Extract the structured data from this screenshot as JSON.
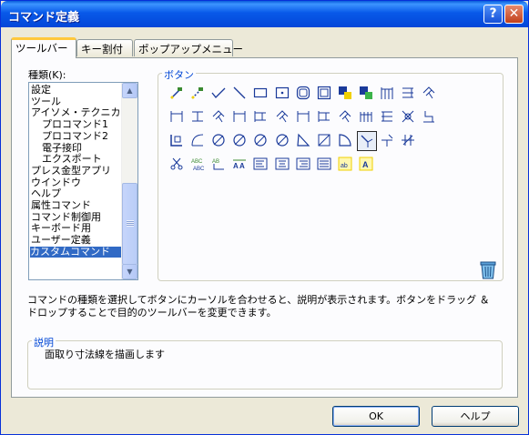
{
  "window": {
    "title": "コマンド定義"
  },
  "tabs": [
    "ツールバー",
    "キー割付",
    "ポップアップメニュー"
  ],
  "category": {
    "label": "種類(K):",
    "items": [
      "設定",
      "ツール",
      "アイソメ・テクニカル",
      "プロコマンド1",
      "プロコマンド2",
      "電子接印",
      "エクスポート",
      "プレス金型アプリ",
      "ウインドウ",
      "ヘルプ",
      "属性コマンド",
      "コマンド制御用",
      "キーボード用",
      "ユーザー定義",
      "カスタムコマンド"
    ],
    "selected": "カスタムコマンド"
  },
  "buttons_group": {
    "label": "ボタン",
    "rows": [
      [
        "line-pen-icon",
        "line-pen-dotted-icon",
        "check-angle-icon",
        "diagonal-line-icon",
        "rectangle-icon",
        "rectangle-dot-icon",
        "rounded-square-icon",
        "double-square-icon",
        "yellow-block-icon",
        "green-block-icon",
        "dimension-h-icon",
        "dimension-stack-icon",
        "dimension-angle-icon"
      ],
      [
        "dimension-span-icon",
        "dimension-bracket-icon",
        "dimension-angle-icon",
        "dimension-span-icon",
        "dimension-vert-icon",
        "dimension-angle-icon",
        "dimension-span-icon",
        "dimension-vert-icon",
        "dimension-angle-icon",
        "dimension-multi-icon",
        "dimension-right-icon",
        "cross-dimension-icon",
        "ordinate-icon"
      ],
      [
        "l-shape-icon",
        "arc-dimension-icon",
        "circle-slash-icon",
        "circle-slash-icon",
        "circle-slash-icon",
        "circle-slash-icon",
        "triangle-icon",
        "square-slash-icon",
        "quarter-arc-icon",
        "chamfer-dimension-icon",
        "leader-icon",
        "cross-hatch-icon"
      ],
      [
        "scissors-icon",
        "abc-replace-icon",
        "text-leader-icon",
        "text-aa-icon",
        "text-align-left-icon",
        "text-align-center-icon",
        "text-align-right-icon",
        "text-justify-icon",
        "yellow-text-box-icon",
        "yellow-text-a-icon"
      ]
    ],
    "selected_icon": "chamfer-dimension-icon"
  },
  "trash_icon": "recycle-bin-icon",
  "instruction": "コマンドの種類を選択してボタンにカーソルを合わせると、説明が表示されます。ボタンをドラッグ ＆ ドロップすることで目的のツールバーを変更できます。",
  "description": {
    "label": "説明",
    "text": "面取り寸法線を描画します"
  },
  "ok_label": "OK",
  "help_label": "ヘルプ"
}
